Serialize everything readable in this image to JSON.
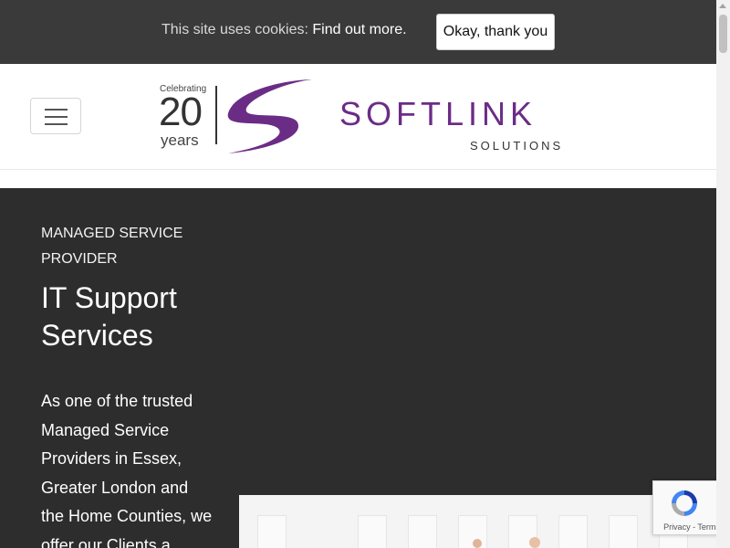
{
  "cookie_bar": {
    "message": "This site uses cookies: ",
    "link_text": "Find out more.",
    "accept_label": "Okay, thank you"
  },
  "header": {
    "menu_icon": "hamburger-menu-icon",
    "logo": {
      "badge_top": "Celebrating",
      "badge_number": "20",
      "badge_bottom": "years",
      "brand_name": "SOFTLINK",
      "brand_sub": "SOLUTIONS"
    }
  },
  "hero": {
    "eyebrow": "MANAGED SERVICE PROVIDER",
    "title": "IT Support Services",
    "body": "As one of the trusted Managed Service Providers in Essex, Greater London and the Home Counties, we offer our Clients a"
  },
  "recaptcha": {
    "icon": "recaptcha-icon",
    "privacy_label": "Privacy",
    "separator": " - ",
    "terms_label": "Terms"
  },
  "colors": {
    "brand_purple": "#6b2c86",
    "cookie_bar_bg": "#3a3a3a",
    "hero_bg": "#2d2d2d"
  }
}
